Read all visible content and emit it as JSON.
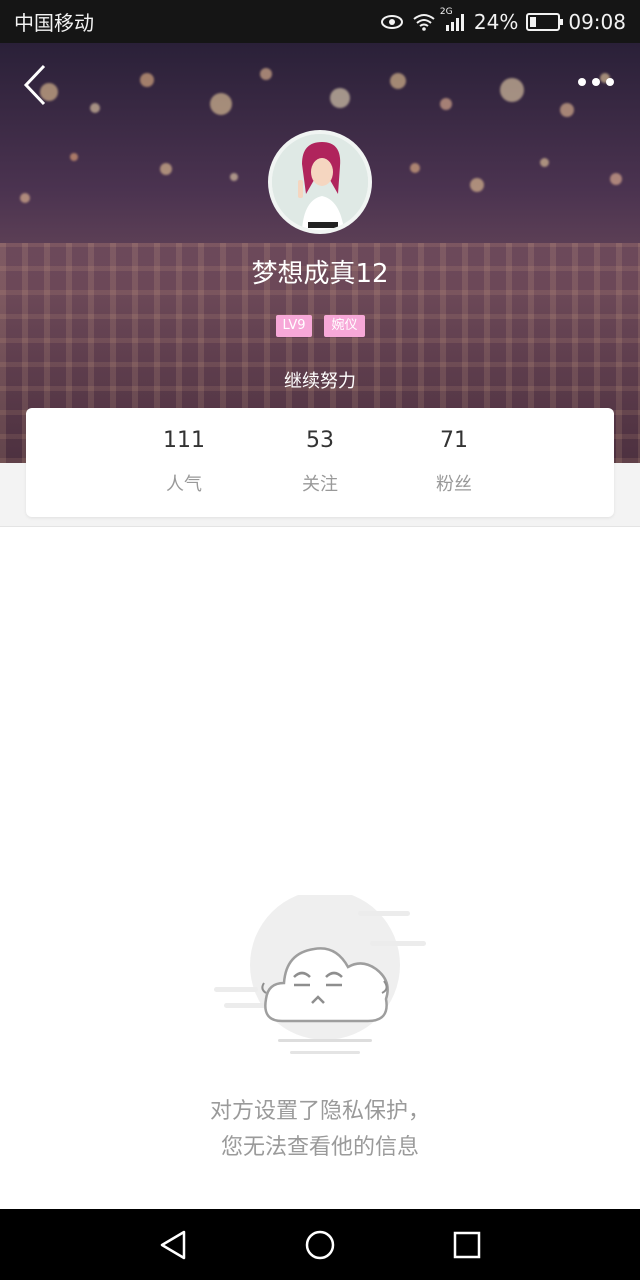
{
  "status_bar": {
    "carrier": "中国移动",
    "network": "2G",
    "battery": "24%",
    "battery_level": 0.24,
    "time": "09:08"
  },
  "profile": {
    "nickname": "梦想成真12",
    "badges": [
      "LV9",
      "婉仪"
    ],
    "signature": "继续努力"
  },
  "stats": [
    {
      "value": "111",
      "label": "人气"
    },
    {
      "value": "53",
      "label": "关注"
    },
    {
      "value": "71",
      "label": "粉丝"
    }
  ],
  "empty_state": {
    "line1": "对方设置了隐私保护，",
    "line2": "您无法查看他的信息"
  },
  "icons": {
    "back": "back-arrow-icon",
    "more": "more-dots-icon",
    "eye": "eye-icon",
    "wifi": "wifi-icon",
    "signal": "signal-icon",
    "battery": "battery-icon",
    "nav_back": "nav-back-icon",
    "nav_home": "nav-home-icon",
    "nav_recent": "nav-recent-icon",
    "empty": "cloud-face-icon"
  },
  "colors": {
    "badge": "#f7a8d8",
    "text_muted": "#999999",
    "stat_value": "#333333"
  }
}
